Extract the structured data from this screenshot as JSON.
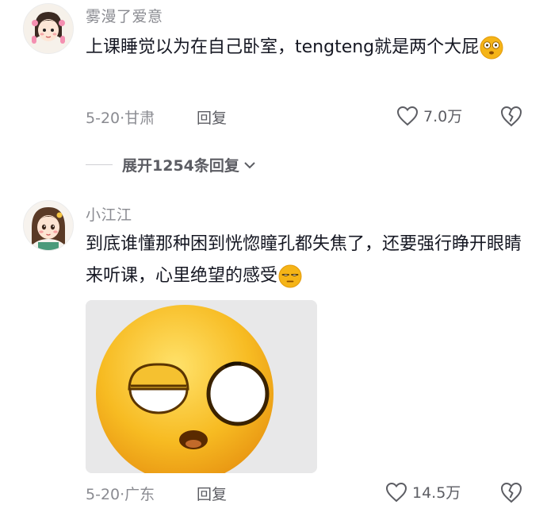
{
  "comments": [
    {
      "username": "雾漫了爱意",
      "text": "上课睡觉以为在自己卧室，tengteng就是两个大屁",
      "inline_emoji": "dizzy-face-emoji",
      "date": "5-20",
      "location": "甘肃",
      "reply_label": "回复",
      "likes": "7.0万",
      "expand_replies": "展开1254条回复"
    },
    {
      "username": "小江江",
      "text": "到底谁懂那种困到恍惚瞳孔都失焦了，还要强行睁开眼睛来听课，心里绝望的感受",
      "inline_emoji": "sleepy-face-emoji",
      "sticker": "mismatched-eyes-emoji-sticker",
      "date": "5-20",
      "location": "广东",
      "reply_label": "回复",
      "likes": "14.5万"
    }
  ],
  "icons": {
    "like": "heart-outline-icon",
    "dislike": "broken-heart-icon",
    "expand": "chevron-down-icon"
  },
  "colors": {
    "text": "#161823",
    "secondary": "#8a8b91",
    "emoji": "#f5b417"
  }
}
